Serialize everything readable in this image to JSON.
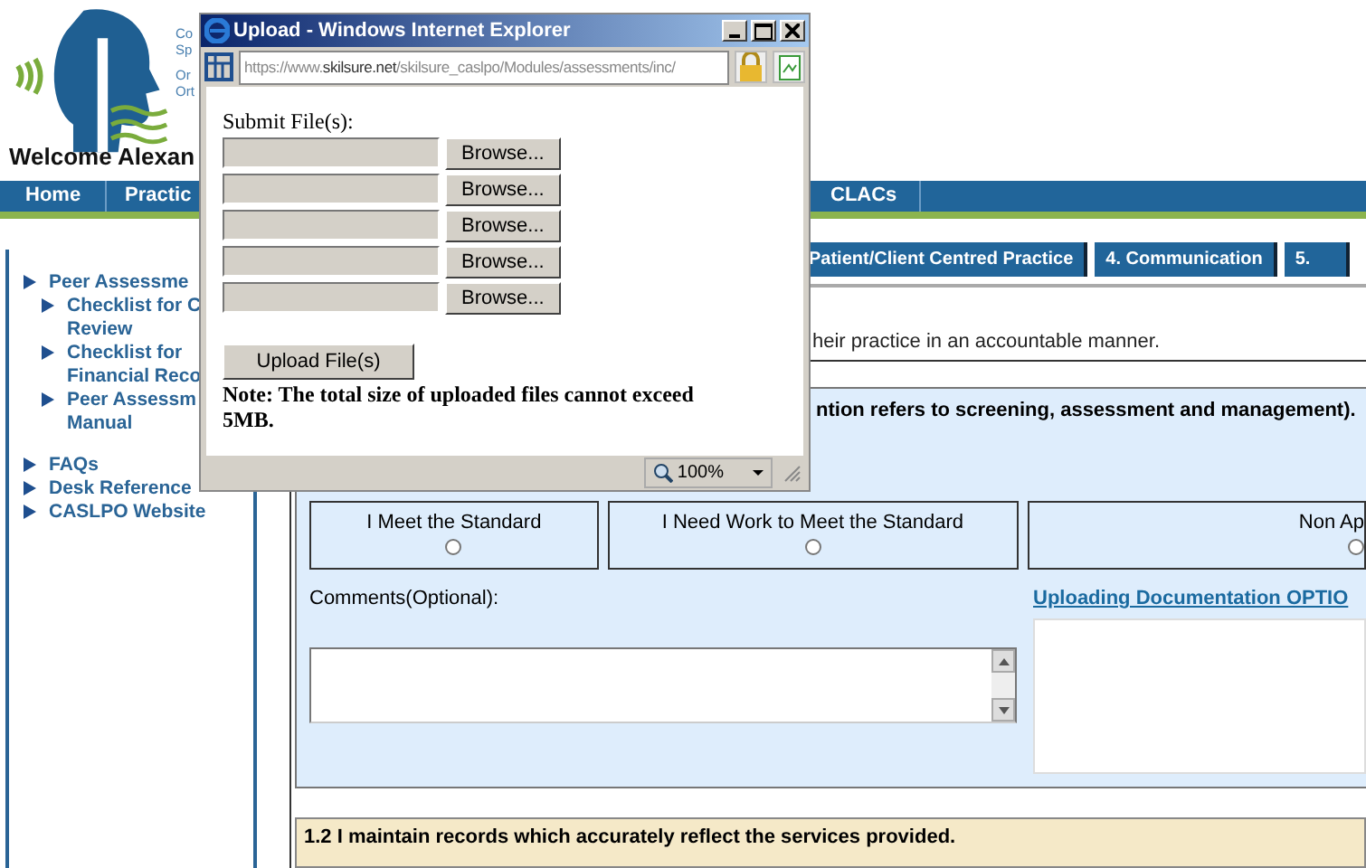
{
  "header": {
    "logo_text": [
      "Co",
      "Sp",
      "Or",
      "Ort"
    ],
    "welcome": "Welcome Alexan"
  },
  "nav": {
    "items": [
      "Home",
      "Practic"
    ],
    "right_items": [
      "CLACs"
    ]
  },
  "sidebar": {
    "groups": [
      {
        "items": [
          {
            "lines": [
              "Peer Assessme"
            ],
            "children": [
              {
                "lines": [
                  "Checklist for C",
                  "Review"
                ]
              },
              {
                "lines": [
                  "Checklist for",
                  "Financial Reco"
                ]
              },
              {
                "lines": [
                  "Peer Assessm",
                  "Manual"
                ]
              }
            ]
          }
        ]
      },
      {
        "items": [
          {
            "lines": [
              "FAQs"
            ]
          },
          {
            "lines": [
              "Desk Reference"
            ]
          },
          {
            "lines": [
              "CASLPO Website"
            ]
          }
        ]
      }
    ]
  },
  "tabs": [
    "Patient/Client Centred Practice",
    "4. Communication",
    "5."
  ],
  "description": "heir practice in an accountable manner.",
  "standard": {
    "title": "ntion refers to screening, assessment and management).",
    "options": [
      {
        "label": "I Meet the Standard",
        "selected": false
      },
      {
        "label": "I Need Work to Meet the Standard",
        "selected": false
      },
      {
        "label": "Non Ap",
        "selected": false
      }
    ],
    "comments_label": "Comments(Optional):",
    "upload_link": "Uploading Documentation OPTIO"
  },
  "next_standard": "1.2 I maintain records which accurately reflect the services provided.",
  "popup": {
    "title": "Upload - Windows Internet Explorer",
    "address": {
      "scheme": "https://www.",
      "domain": "skilsure.net",
      "path": "/skilsure_caslpo/Modules/assessments/inc/"
    },
    "label": "Submit File(s):",
    "browse": [
      "Browse...",
      "Browse...",
      "Browse...",
      "Browse...",
      "Browse..."
    ],
    "upload": "Upload File(s)",
    "note": "Note: The total size of uploaded files cannot exceed 5MB.",
    "zoom": "100%"
  }
}
